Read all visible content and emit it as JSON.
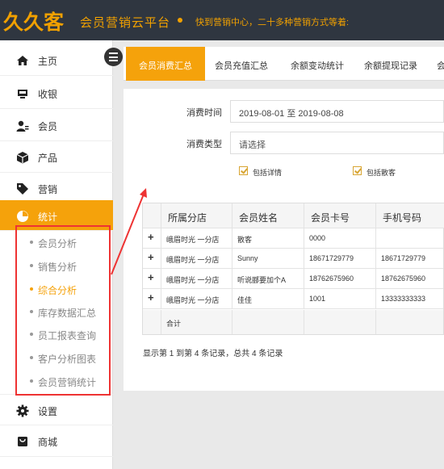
{
  "header": {
    "logo_text": "久久客",
    "app_title": "会员营销云平台",
    "marquee": "快到营销中心，二十多种营销方式等着:"
  },
  "sidebar": {
    "items": [
      {
        "label": "主页",
        "icon": "home-icon"
      },
      {
        "label": "收银",
        "icon": "cash-register-icon"
      },
      {
        "label": "会员",
        "icon": "member-icon"
      },
      {
        "label": "产品",
        "icon": "box-icon"
      },
      {
        "label": "营销",
        "icon": "tag-icon"
      },
      {
        "label": "统计",
        "icon": "pie-chart-icon"
      },
      {
        "label": "设置",
        "icon": "gear-icon"
      },
      {
        "label": "商城",
        "icon": "shop-icon"
      }
    ],
    "stats_submenu": [
      "会员分析",
      "销售分析",
      "综合分析",
      "库存数据汇总",
      "员工报表查询",
      "客户分析图表",
      "会员营销统计"
    ],
    "active_item": "统计",
    "current_subitem": "综合分析"
  },
  "tabs": [
    "会员消费汇总",
    "会员充值汇总",
    "余额变动统计",
    "余额提现记录",
    "会"
  ],
  "filters": {
    "time_label": "消费时间",
    "time_value": "2019-08-01 至 2019-08-08",
    "type_label": "消费类型",
    "type_placeholder": "请选择",
    "check_detail": "包括详情",
    "check_guest": "包括散客"
  },
  "table": {
    "columns": [
      "所属分店",
      "会员姓名",
      "会员卡号",
      "手机号码"
    ],
    "rows": [
      {
        "store": "峨眉时光 一分店",
        "name": "散客",
        "card": "0000",
        "phone": ""
      },
      {
        "store": "峨眉时光 一分店",
        "name": "Sunny",
        "card": "18671729779",
        "phone": "18671729779"
      },
      {
        "store": "峨眉时光 一分店",
        "name": "听说郦要加个A",
        "card": "18762675960",
        "phone": "18762675960"
      },
      {
        "store": "峨眉时光 一分店",
        "name": "佳佳",
        "card": "1001",
        "phone": "13333333333"
      }
    ],
    "summary_label": "合计",
    "expand_symbol": "+"
  },
  "pagination": "显示第 1 到第 4 条记录，总共 4 条记录",
  "colors": {
    "accent": "#f5a20b",
    "header_bg": "#2f3640",
    "annotation": "#e33"
  }
}
